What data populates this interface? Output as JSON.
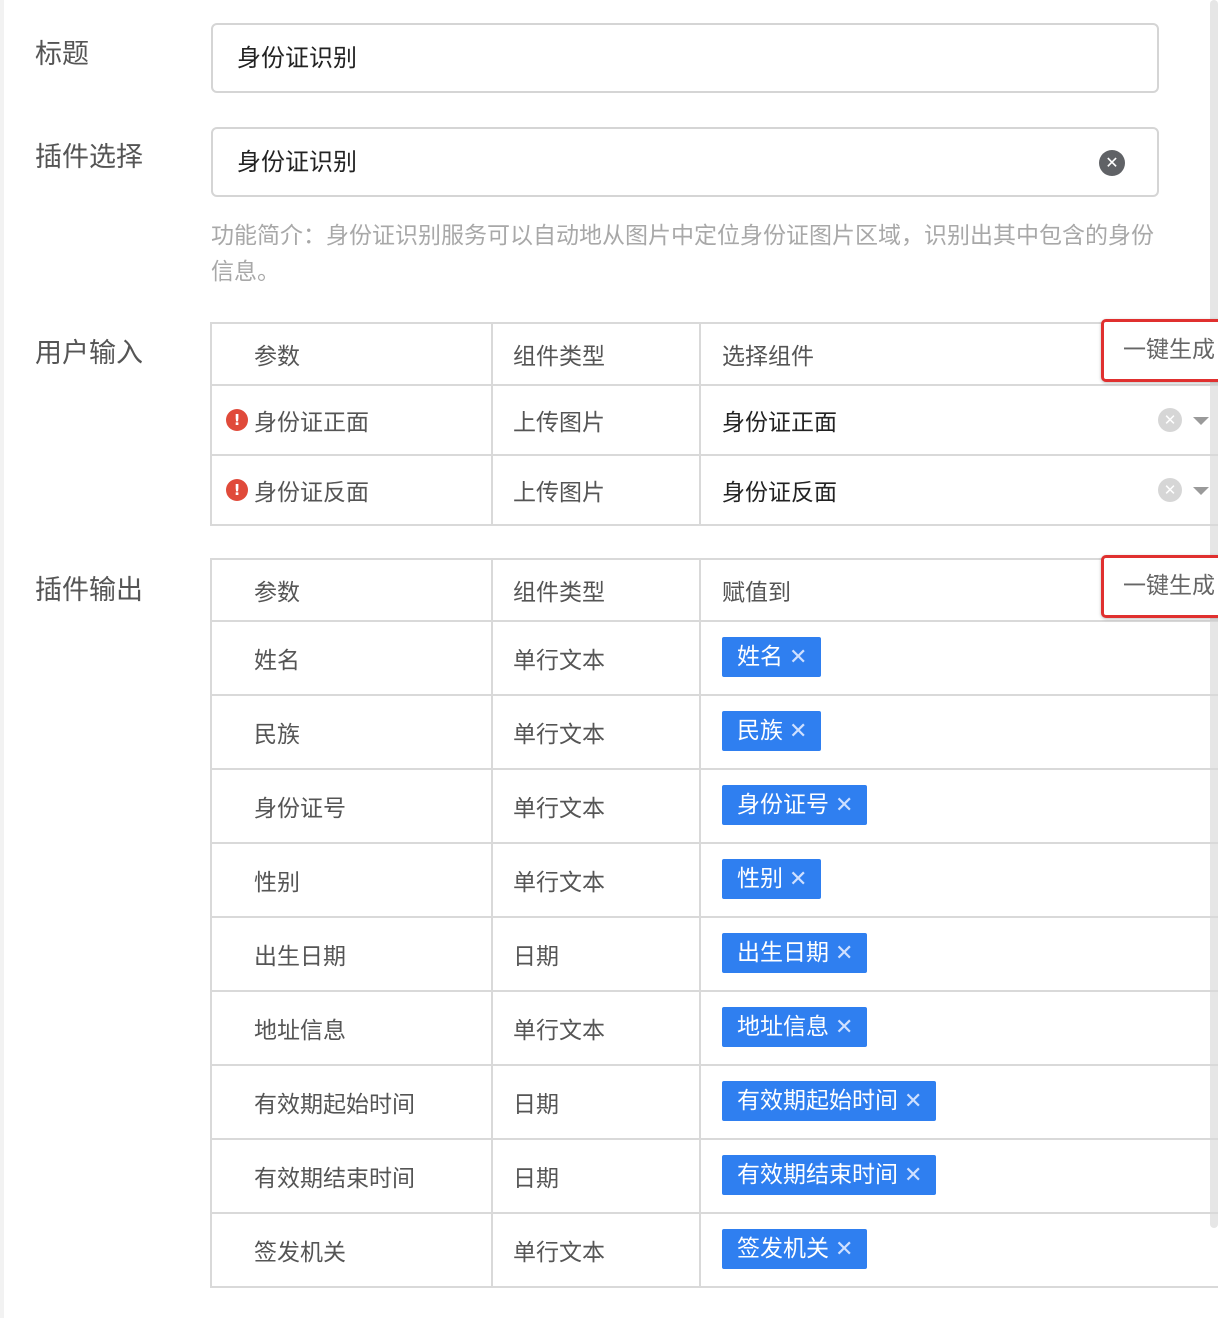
{
  "form": {
    "title_label": "标题",
    "title_value": "身份证识别",
    "plugin_label": "插件选择",
    "plugin_value": "身份证识别",
    "plugin_description": "功能简介：身份证识别服务可以自动地从图片中定位身份证图片区域，识别出其中包含的身份信息。",
    "user_input_label": "用户输入",
    "plugin_output_label": "插件输出"
  },
  "icons": {
    "clear": "close-circle-icon",
    "required": "exclamation-circle-icon",
    "dropdown": "caret-down-icon",
    "tag_remove": "close-icon"
  },
  "colors": {
    "tag_bg": "#2f7ff0",
    "highlight_border": "#e0302f",
    "required_icon": "#e04a3a"
  },
  "user_input_table": {
    "headers": [
      "参数",
      "组件类型",
      "选择组件"
    ],
    "generate_label": "一键生成",
    "rows": [
      {
        "param": "身份证正面",
        "type": "上传图片",
        "selected": "身份证正面"
      },
      {
        "param": "身份证反面",
        "type": "上传图片",
        "selected": "身份证反面"
      }
    ]
  },
  "plugin_output_table": {
    "headers": [
      "参数",
      "组件类型",
      "赋值到"
    ],
    "generate_label": "一键生成",
    "rows": [
      {
        "param": "姓名",
        "type": "单行文本",
        "tag": "姓名"
      },
      {
        "param": "民族",
        "type": "单行文本",
        "tag": "民族"
      },
      {
        "param": "身份证号",
        "type": "单行文本",
        "tag": "身份证号"
      },
      {
        "param": "性别",
        "type": "单行文本",
        "tag": "性别"
      },
      {
        "param": "出生日期",
        "type": "日期",
        "tag": "出生日期"
      },
      {
        "param": "地址信息",
        "type": "单行文本",
        "tag": "地址信息"
      },
      {
        "param": "有效期起始时间",
        "type": "日期",
        "tag": "有效期起始时间"
      },
      {
        "param": "有效期结束时间",
        "type": "日期",
        "tag": "有效期结束时间"
      },
      {
        "param": "签发机关",
        "type": "单行文本",
        "tag": "签发机关"
      }
    ]
  }
}
